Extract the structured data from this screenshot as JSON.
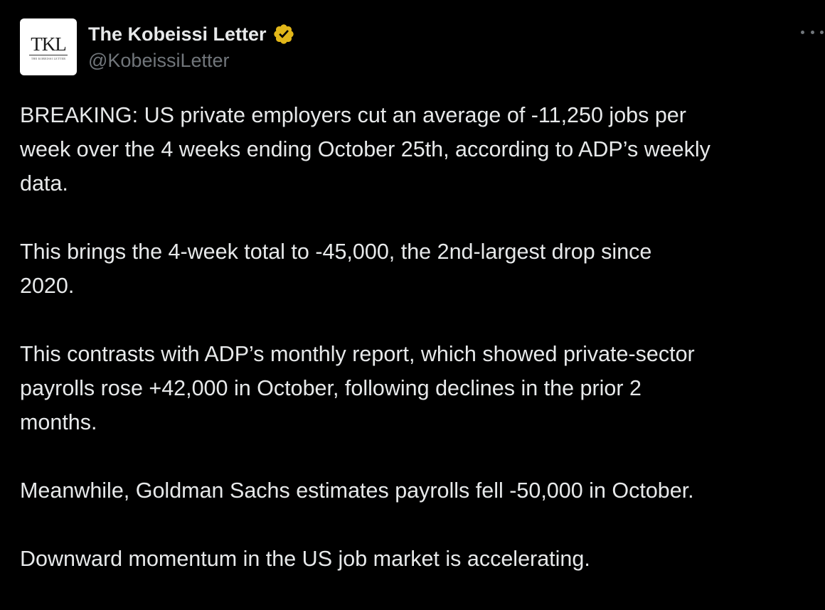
{
  "author": {
    "display_name": "The Kobeissi Letter",
    "handle": "@KobeissiLetter",
    "avatar_text": "TKL",
    "avatar_subtext": "THE KOBEISSI LETTER",
    "verified_badge": "gold-verified-badge-icon"
  },
  "menu": {
    "icon": "more-options-icon"
  },
  "tweet": {
    "paragraphs": [
      "BREAKING: US private employers cut an average of -11,250 jobs per\nweek over the 4 weeks ending October 25th, according to ADP’s weekly\ndata.",
      "This brings the 4-week total to -45,000, the 2nd-largest drop since\n2020.",
      "This contrasts with ADP’s monthly report, which showed private-sector\npayrolls rose +42,000 in October, following declines in the prior 2\nmonths.",
      "Meanwhile, Goldman Sachs estimates payrolls fell -50,000 in October.",
      "Downward momentum in the US job market is accelerating."
    ]
  },
  "colors": {
    "background": "#000000",
    "primary_text": "#e7e9ea",
    "secondary_text": "#71767b",
    "badge_gold": "#e2b719"
  }
}
